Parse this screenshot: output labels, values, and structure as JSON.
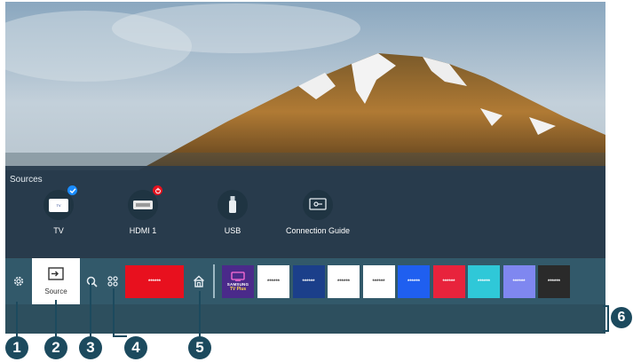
{
  "sources": {
    "title": "Sources",
    "items": [
      {
        "label": "TV",
        "icon": "samsung-tv-plus-icon",
        "badge": "check-badge"
      },
      {
        "label": "HDMI 1",
        "icon": "hdmi-icon",
        "badge": "power-badge"
      },
      {
        "label": "USB",
        "icon": "usb-icon"
      },
      {
        "label": "Connection Guide",
        "icon": "connection-guide-icon"
      }
    ]
  },
  "home_bar": {
    "settings_icon": "gear-icon",
    "source_label": "Source",
    "search_icon": "search-icon",
    "apps_icon": "apps-icon",
    "featured_tile_text": "******",
    "home_icon": "home-icon",
    "tv_plus_brand": "SAMSUNG",
    "tv_plus_label": "TV Plus",
    "app_tiles": [
      {
        "text": "******",
        "bg": "#ffffff",
        "fg": "#333333"
      },
      {
        "text": "******",
        "bg": "#1b3f8a",
        "fg": "#ffffff"
      },
      {
        "text": "******",
        "bg": "#ffffff",
        "fg": "#333333"
      },
      {
        "text": "******",
        "bg": "#ffffff",
        "fg": "#333333"
      },
      {
        "text": "******",
        "bg": "#1f5ff0",
        "fg": "#ffffff"
      },
      {
        "text": "******",
        "bg": "#e8233c",
        "fg": "#ffffff"
      },
      {
        "text": "******",
        "bg": "#2fc8d8",
        "fg": "#ffffff"
      },
      {
        "text": "******",
        "bg": "#7f87f0",
        "fg": "#ffffff"
      },
      {
        "text": "******",
        "bg": "#2a2a2a",
        "fg": "#ffffff"
      }
    ]
  },
  "callouts": [
    "1",
    "2",
    "3",
    "4",
    "5",
    "6"
  ],
  "colors": {
    "accent_red": "#e8101e",
    "tv_plus_purple": "#4a2a8a",
    "callout_blue": "#1c4a5e",
    "check_blue": "#1a8cff"
  }
}
